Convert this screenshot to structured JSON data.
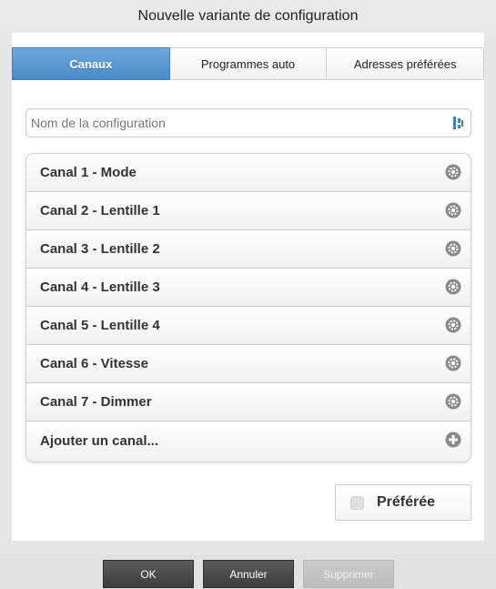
{
  "window": {
    "title": "Nouvelle variante de configuration"
  },
  "tabs": [
    {
      "label": "Canaux",
      "active": true
    },
    {
      "label": "Programmes auto",
      "active": false
    },
    {
      "label": "Adresses préférées",
      "active": false
    }
  ],
  "name_field": {
    "placeholder": "Nom de la configuration",
    "value": "",
    "icon": "bookmark-icon"
  },
  "channels": [
    {
      "label": "Canal 1 - Mode",
      "icon": "gear-icon"
    },
    {
      "label": "Canal 2 - Lentille 1",
      "icon": "gear-icon"
    },
    {
      "label": "Canal 3 - Lentille 2",
      "icon": "gear-icon"
    },
    {
      "label": "Canal 4 - Lentille 3",
      "icon": "gear-icon"
    },
    {
      "label": "Canal 5 - Lentille 4",
      "icon": "gear-icon"
    },
    {
      "label": "Canal 6 - Vitesse",
      "icon": "gear-icon"
    },
    {
      "label": "Canal 7 - Dimmer",
      "icon": "gear-icon"
    }
  ],
  "add_channel": {
    "label": "Ajouter un canal...",
    "icon": "plus-icon"
  },
  "preferred": {
    "label": "Préférée",
    "checked": false
  },
  "footer": {
    "ok_label": "OK",
    "cancel_label": "Annuler",
    "delete_label": "Supprimer",
    "delete_enabled": false
  },
  "colors": {
    "accent": "#4a8cc8",
    "button_dark": "#444444",
    "button_disabled": "#c4c4c4"
  }
}
